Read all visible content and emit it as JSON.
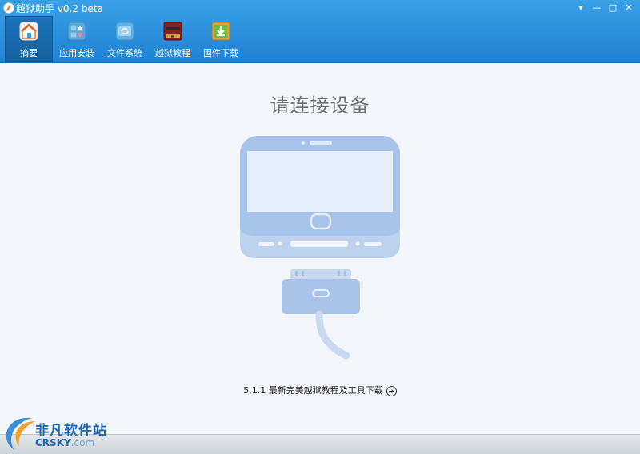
{
  "window": {
    "title": "越狱助手  v0.2 beta",
    "controls": {
      "menu": "▾",
      "minimize": "—",
      "maximize": "□",
      "close": "✕"
    }
  },
  "toolbar": {
    "items": [
      {
        "label": "摘要",
        "icon": "home-icon",
        "active": true
      },
      {
        "label": "应用安装",
        "icon": "apps-icon",
        "active": false
      },
      {
        "label": "文件系统",
        "icon": "filesystem-icon",
        "active": false
      },
      {
        "label": "越狱教程",
        "icon": "book-icon",
        "active": false
      },
      {
        "label": "固件下载",
        "icon": "download-icon",
        "active": false
      }
    ]
  },
  "main": {
    "heading": "请连接设备",
    "link_text": "5.1.1 最新完美越狱教程及工具下载"
  },
  "watermark": {
    "cn": "非凡软件站",
    "en": "CRSKY",
    "domain": ".com"
  },
  "colors": {
    "titlebar": "#2b92dd",
    "device": "#a9c6ea",
    "heading": "#6b6f73",
    "watermark": "#1d68b8"
  }
}
